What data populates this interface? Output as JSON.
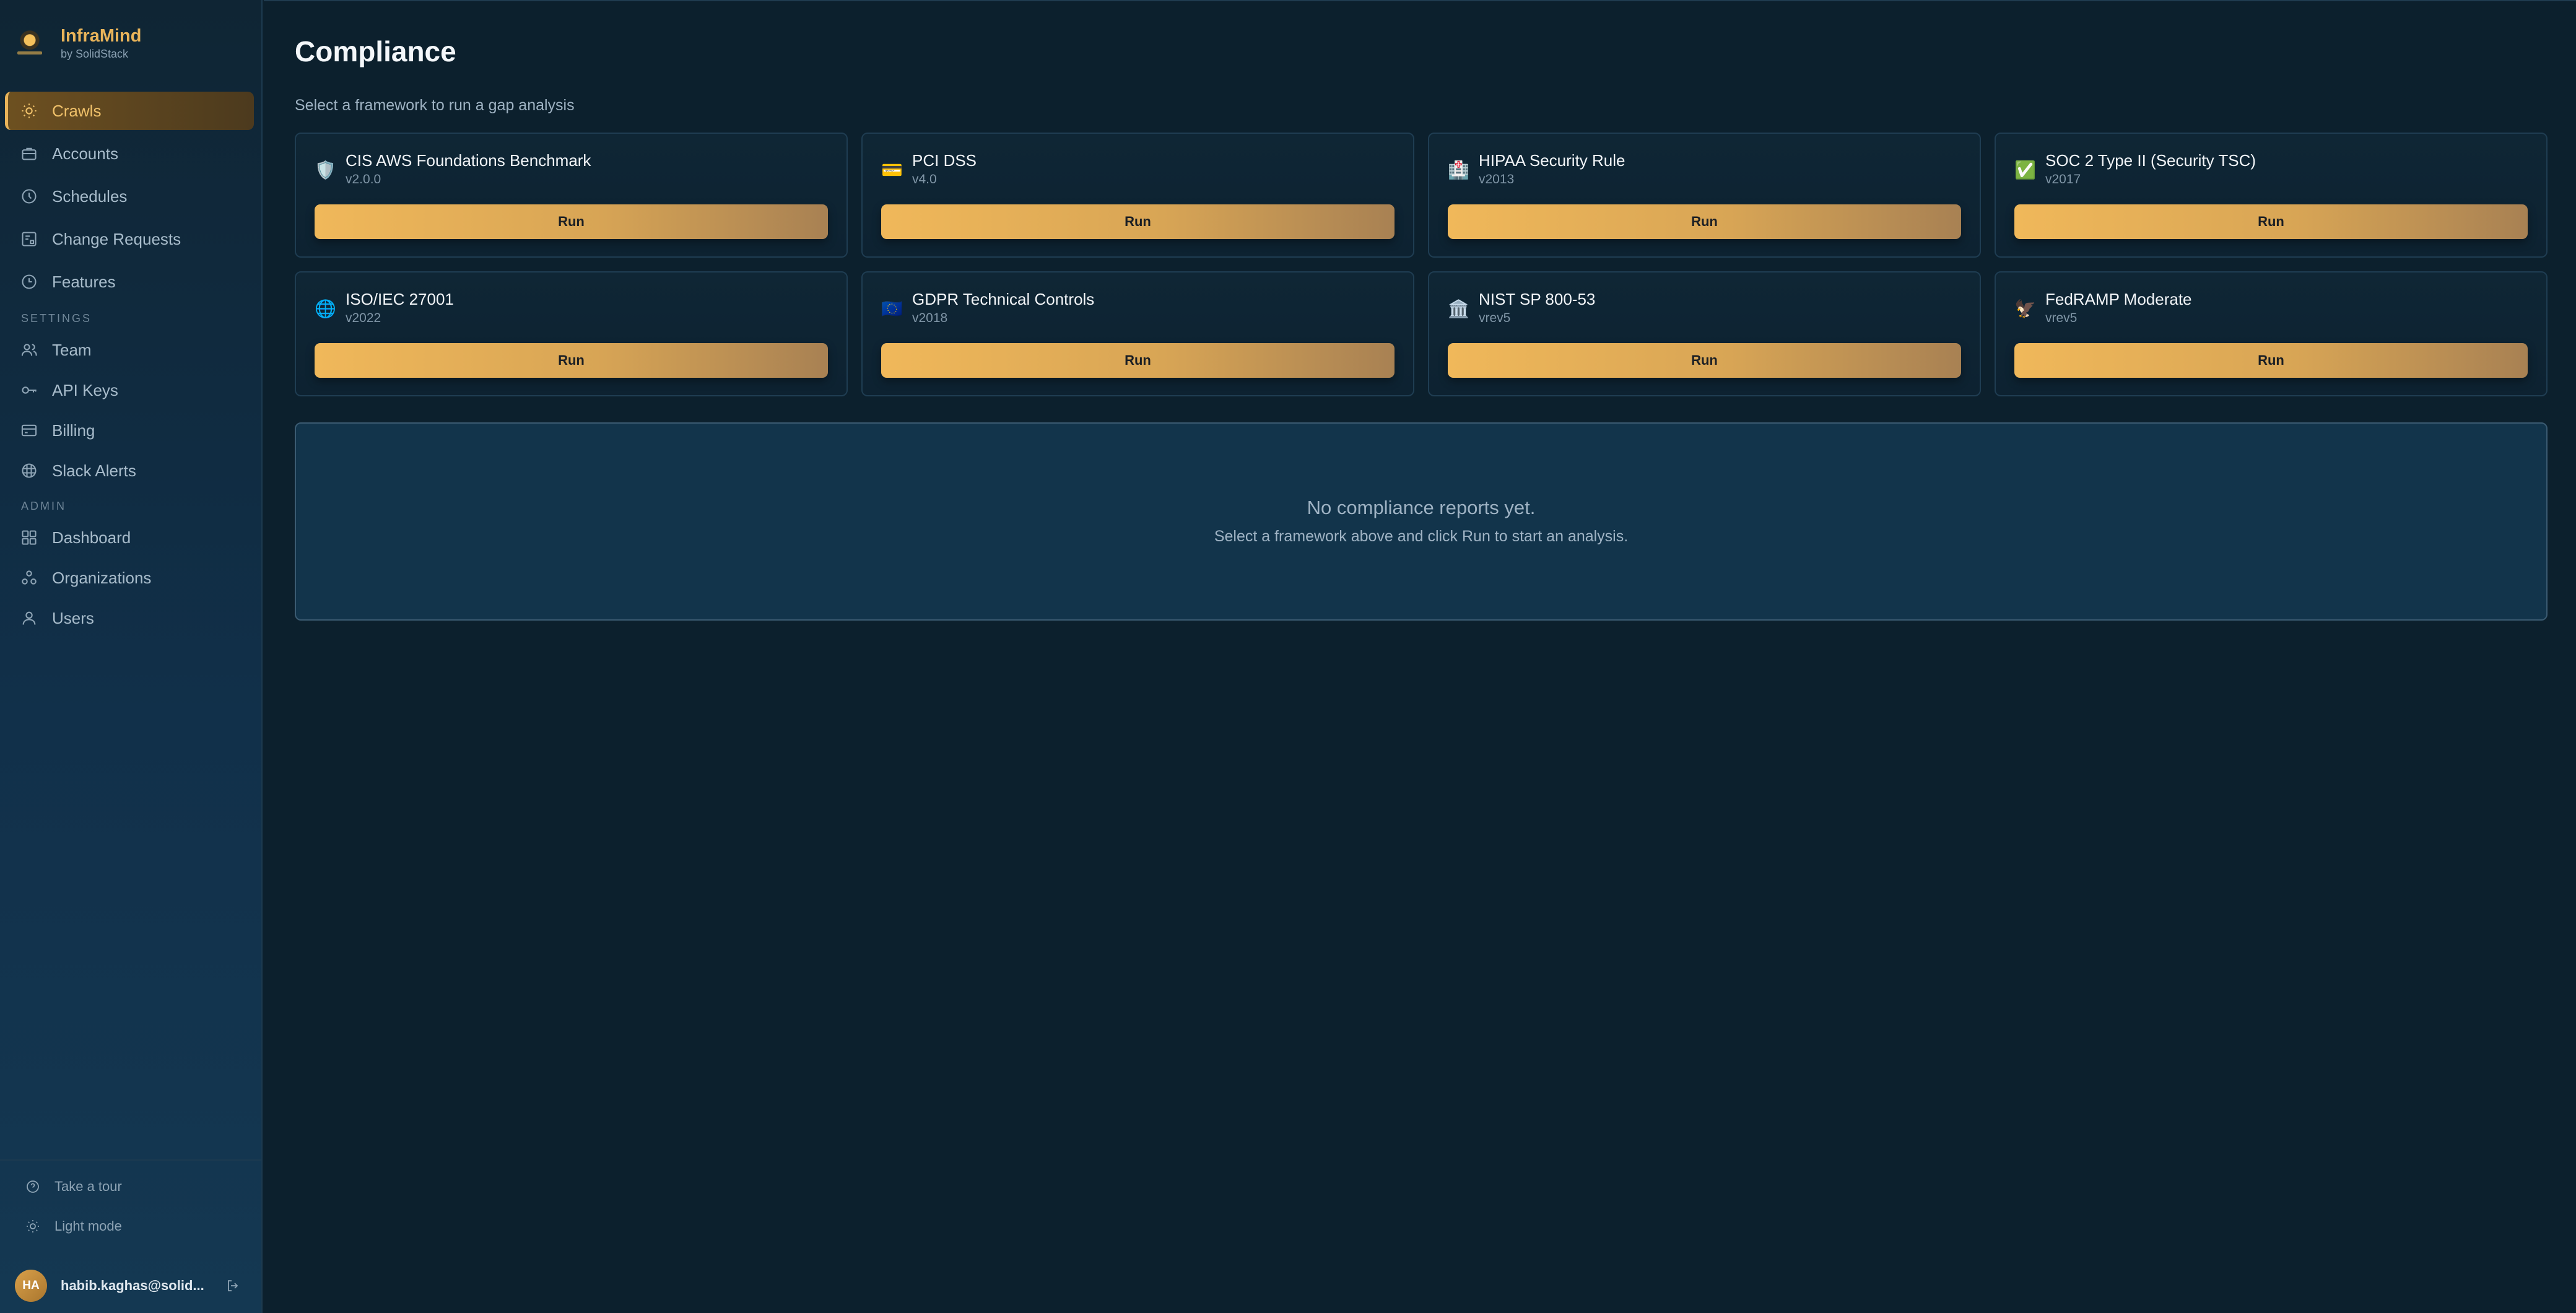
{
  "brand": {
    "name": "InfraMind",
    "sub": "by SolidStack"
  },
  "nav": {
    "main": [
      {
        "label": "Crawls",
        "icon": "sun-icon",
        "active": true
      },
      {
        "label": "Accounts",
        "icon": "briefcase-icon"
      },
      {
        "label": "Schedules",
        "icon": "clock-icon"
      },
      {
        "label": "Change Requests",
        "icon": "git-pr-icon"
      },
      {
        "label": "Features",
        "icon": "history-icon"
      }
    ],
    "settings_label": "SETTINGS",
    "settings": [
      {
        "label": "Team",
        "icon": "users-icon"
      },
      {
        "label": "API Keys",
        "icon": "key-icon"
      },
      {
        "label": "Billing",
        "icon": "credit-card-icon"
      },
      {
        "label": "Slack Alerts",
        "icon": "slack-icon"
      }
    ],
    "admin_label": "ADMIN",
    "admin": [
      {
        "label": "Dashboard",
        "icon": "grid-icon"
      },
      {
        "label": "Organizations",
        "icon": "org-icon"
      },
      {
        "label": "Users",
        "icon": "user-icon"
      }
    ]
  },
  "footer": {
    "tour": "Take a tour",
    "theme": "Light mode",
    "user_initials": "HA",
    "user_email": "habib.kaghas@solid..."
  },
  "page": {
    "title": "Compliance",
    "subtitle": "Select a framework to run a gap analysis",
    "run_label": "Run",
    "frameworks": [
      {
        "name": "CIS AWS Foundations Benchmark",
        "version": "v2.0.0",
        "icon": "shield-icon",
        "emoji": "🛡️"
      },
      {
        "name": "PCI DSS",
        "version": "v4.0",
        "icon": "credit-card-icon",
        "emoji": "💳"
      },
      {
        "name": "HIPAA Security Rule",
        "version": "v2013",
        "icon": "hospital-icon",
        "emoji": "🏥"
      },
      {
        "name": "SOC 2 Type II (Security TSC)",
        "version": "v2017",
        "icon": "check-mark-icon",
        "emoji": "✅"
      },
      {
        "name": "ISO/IEC 27001",
        "version": "v2022",
        "icon": "globe-icon",
        "emoji": "🌐"
      },
      {
        "name": "GDPR Technical Controls",
        "version": "v2018",
        "icon": "eu-flag-icon",
        "emoji": "🇪🇺"
      },
      {
        "name": "NIST SP 800-53",
        "version": "vrev5",
        "icon": "bank-icon",
        "emoji": "🏛️"
      },
      {
        "name": "FedRAMP Moderate",
        "version": "vrev5",
        "icon": "eagle-icon",
        "emoji": "🦅"
      }
    ],
    "empty_title": "No compliance reports yet.",
    "empty_sub": "Select a framework above and click Run to start an analysis."
  },
  "colors": {
    "accent": "#e9b45a",
    "background": "#0c202d",
    "sidebar": "#11304a",
    "button": "#f0b85a"
  }
}
